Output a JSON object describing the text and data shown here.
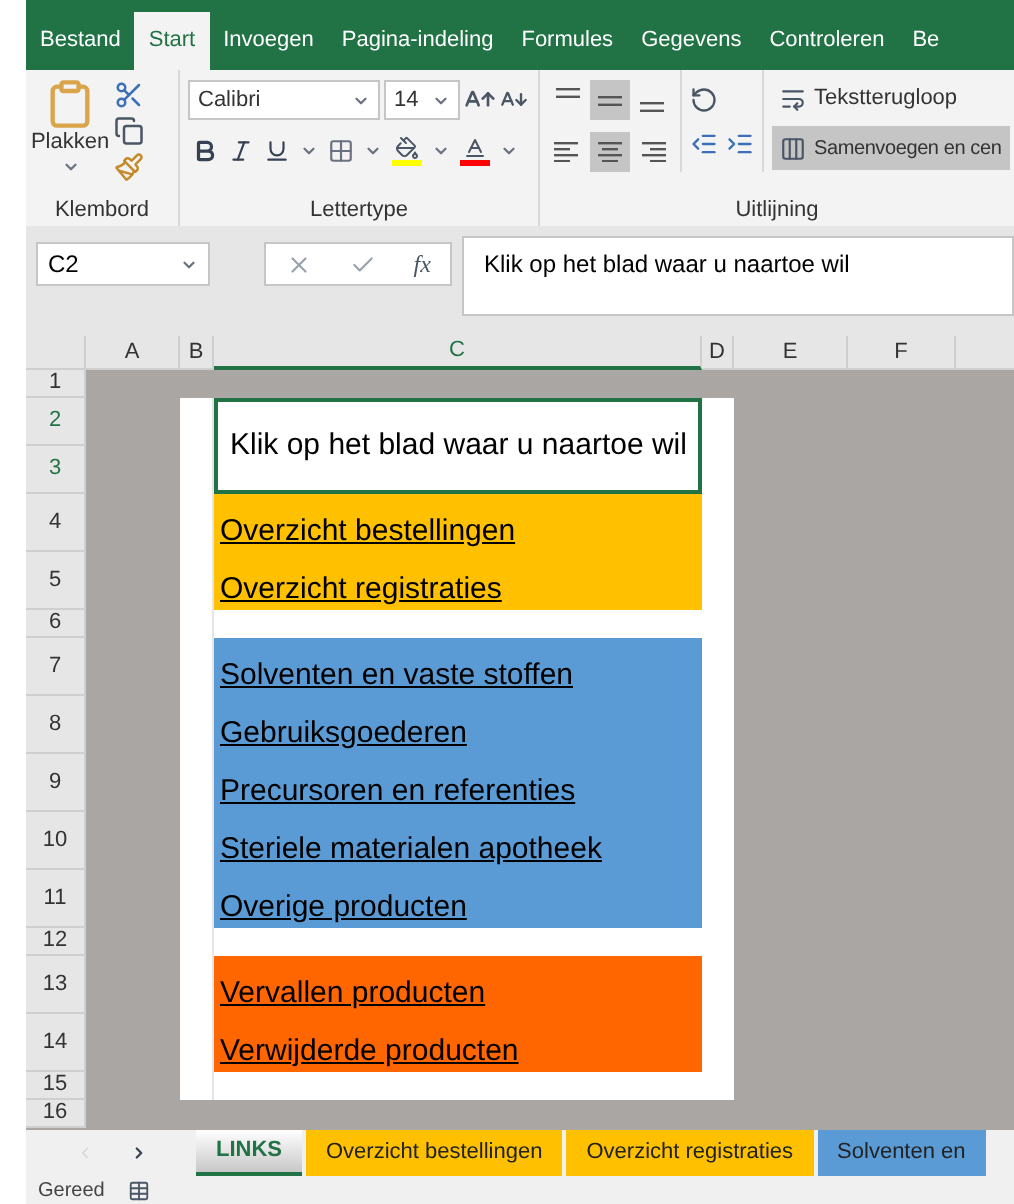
{
  "ribbon_tabs": [
    {
      "label": "Bestand",
      "selected": false
    },
    {
      "label": "Start",
      "selected": true
    },
    {
      "label": "Invoegen",
      "selected": false
    },
    {
      "label": "Pagina-indeling",
      "selected": false
    },
    {
      "label": "Formules",
      "selected": false
    },
    {
      "label": "Gegevens",
      "selected": false
    },
    {
      "label": "Controleren",
      "selected": false
    },
    {
      "label": "Be",
      "selected": false
    }
  ],
  "clipboard": {
    "paste_label": "Plakken",
    "group_label": "Klembord"
  },
  "font": {
    "name": "Calibri",
    "size": "14",
    "group_label": "Lettertype"
  },
  "alignment": {
    "group_label": "Uitlijning",
    "wrap_label": "Tekstterugloop",
    "merge_label": "Samenvoegen en cen",
    "merge_selected": true,
    "vertical": [
      {
        "kind": "top",
        "selected": false
      },
      {
        "kind": "middle",
        "selected": true
      },
      {
        "kind": "bottom",
        "selected": false
      }
    ],
    "horizontal": [
      {
        "kind": "left",
        "selected": false
      },
      {
        "kind": "center",
        "selected": true
      },
      {
        "kind": "right",
        "selected": false
      }
    ]
  },
  "formula_bar": {
    "name_box": "C2",
    "fx": "fx",
    "formula": "Klik op het blad waar u naartoe wil"
  },
  "columns": [
    {
      "label": "A",
      "selected": false
    },
    {
      "label": "B",
      "selected": false
    },
    {
      "label": "C",
      "selected": true
    },
    {
      "label": "D",
      "selected": false
    },
    {
      "label": "E",
      "selected": false
    },
    {
      "label": "F",
      "selected": false
    }
  ],
  "rows": [
    {
      "number": "1",
      "kind": "outside"
    },
    {
      "number": "2",
      "kind": "title",
      "text": "Klik op het blad waar u naartoe wil"
    },
    {
      "number": "3",
      "kind": "merged"
    },
    {
      "number": "4",
      "kind": "link",
      "text": "Overzicht bestellingen",
      "color": "#ffc000"
    },
    {
      "number": "5",
      "kind": "link",
      "text": "Overzicht registraties",
      "color": "#ffc000"
    },
    {
      "number": "6",
      "kind": "spacer"
    },
    {
      "number": "7",
      "kind": "link",
      "text": "Solventen en vaste stoffen",
      "color": "#5b9bd5"
    },
    {
      "number": "8",
      "kind": "link",
      "text": "Gebruiksgoederen",
      "color": "#5b9bd5"
    },
    {
      "number": "9",
      "kind": "link",
      "text": "Precursoren en referenties",
      "color": "#5b9bd5"
    },
    {
      "number": "10",
      "kind": "link",
      "text": "Steriele materialen apotheek",
      "color": "#5b9bd5"
    },
    {
      "number": "11",
      "kind": "link",
      "text": "Overige producten",
      "color": "#5b9bd5"
    },
    {
      "number": "12",
      "kind": "spacer"
    },
    {
      "number": "13",
      "kind": "link",
      "text": "Vervallen producten",
      "color": "#ff6600"
    },
    {
      "number": "14",
      "kind": "link",
      "text": "Verwijderde producten",
      "color": "#ff6600"
    },
    {
      "number": "15",
      "kind": "spacer"
    },
    {
      "number": "16",
      "kind": "outside"
    }
  ],
  "sheet_tabs": [
    {
      "label": "LINKS",
      "selected": true
    },
    {
      "label": "Overzicht bestellingen",
      "selected": false,
      "color": "#ffc000"
    },
    {
      "label": "Overzicht registraties",
      "selected": false,
      "color": "#ffc000"
    },
    {
      "label": "Solventen en",
      "selected": false,
      "color": "#5b9bd5"
    }
  ],
  "status_bar": {
    "text": "Gereed"
  }
}
